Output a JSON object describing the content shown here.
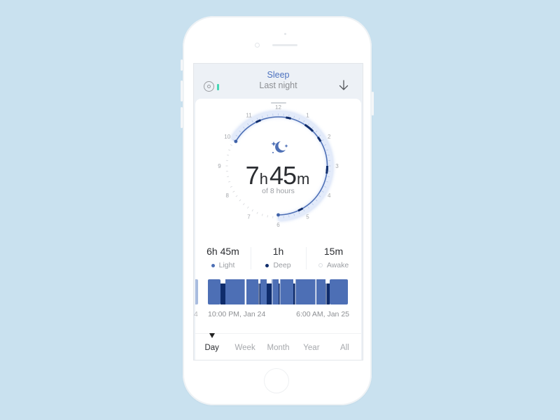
{
  "header": {
    "title": "Sleep",
    "subtitle": "Last night",
    "left_icon": "target-circle-icon",
    "right_icon": "download-arrow-icon",
    "accent": "#4d72bf"
  },
  "clock": {
    "hour_labels": [
      "12",
      "1",
      "2",
      "3",
      "4",
      "5",
      "6",
      "7",
      "8",
      "9",
      "10",
      "11"
    ],
    "sleep_start_hour": 10,
    "sleep_end_hour": 6,
    "icon": "moon-stars-icon",
    "duration": {
      "hours": "7",
      "hours_unit": "h",
      "minutes": "45",
      "minutes_unit": "m"
    },
    "goal_text": "of 8 hours",
    "deep_markers_hours": [
      11.2,
      12.4,
      1.2,
      1.4,
      1.9,
      3.1,
      3.2,
      5.1
    ]
  },
  "stats": [
    {
      "value": "6h 45m",
      "label": "Light",
      "color": "#4d6fb5"
    },
    {
      "value": "1h",
      "label": "Deep",
      "color": "#0f2c6b"
    },
    {
      "value": "15m",
      "label": "Awake",
      "color": "#ffffff"
    }
  ],
  "timeline": {
    "start_label": "10:00 PM, Jan 24",
    "end_label": "6:00 AM, Jan 25",
    "prev_fragment": "4",
    "light_color": "#4d6fb5",
    "deep_color": "#0f2c6b",
    "awake_color": "#ffffff",
    "segments": [
      {
        "stage": "light",
        "start": 0.0,
        "end": 0.09
      },
      {
        "stage": "deep",
        "start": 0.09,
        "end": 0.125
      },
      {
        "stage": "light",
        "start": 0.125,
        "end": 0.265
      },
      {
        "stage": "awake",
        "start": 0.265,
        "end": 0.275
      },
      {
        "stage": "light",
        "start": 0.275,
        "end": 0.36
      },
      {
        "stage": "deep",
        "start": 0.36,
        "end": 0.375
      },
      {
        "stage": "light",
        "start": 0.375,
        "end": 0.42
      },
      {
        "stage": "deep",
        "start": 0.42,
        "end": 0.455
      },
      {
        "stage": "light",
        "start": 0.455,
        "end": 0.505
      },
      {
        "stage": "deep",
        "start": 0.505,
        "end": 0.515
      },
      {
        "stage": "light",
        "start": 0.515,
        "end": 0.61
      },
      {
        "stage": "deep",
        "start": 0.61,
        "end": 0.625
      },
      {
        "stage": "light",
        "start": 0.625,
        "end": 0.77
      },
      {
        "stage": "light",
        "start": 0.775,
        "end": 0.84
      },
      {
        "stage": "deep",
        "start": 0.84,
        "end": 0.87
      },
      {
        "stage": "light",
        "start": 0.87,
        "end": 1.0
      }
    ]
  },
  "tabs": [
    {
      "label": "Day",
      "active": true
    },
    {
      "label": "Week",
      "active": false
    },
    {
      "label": "Month",
      "active": false
    },
    {
      "label": "Year",
      "active": false
    },
    {
      "label": "All",
      "active": false
    }
  ]
}
